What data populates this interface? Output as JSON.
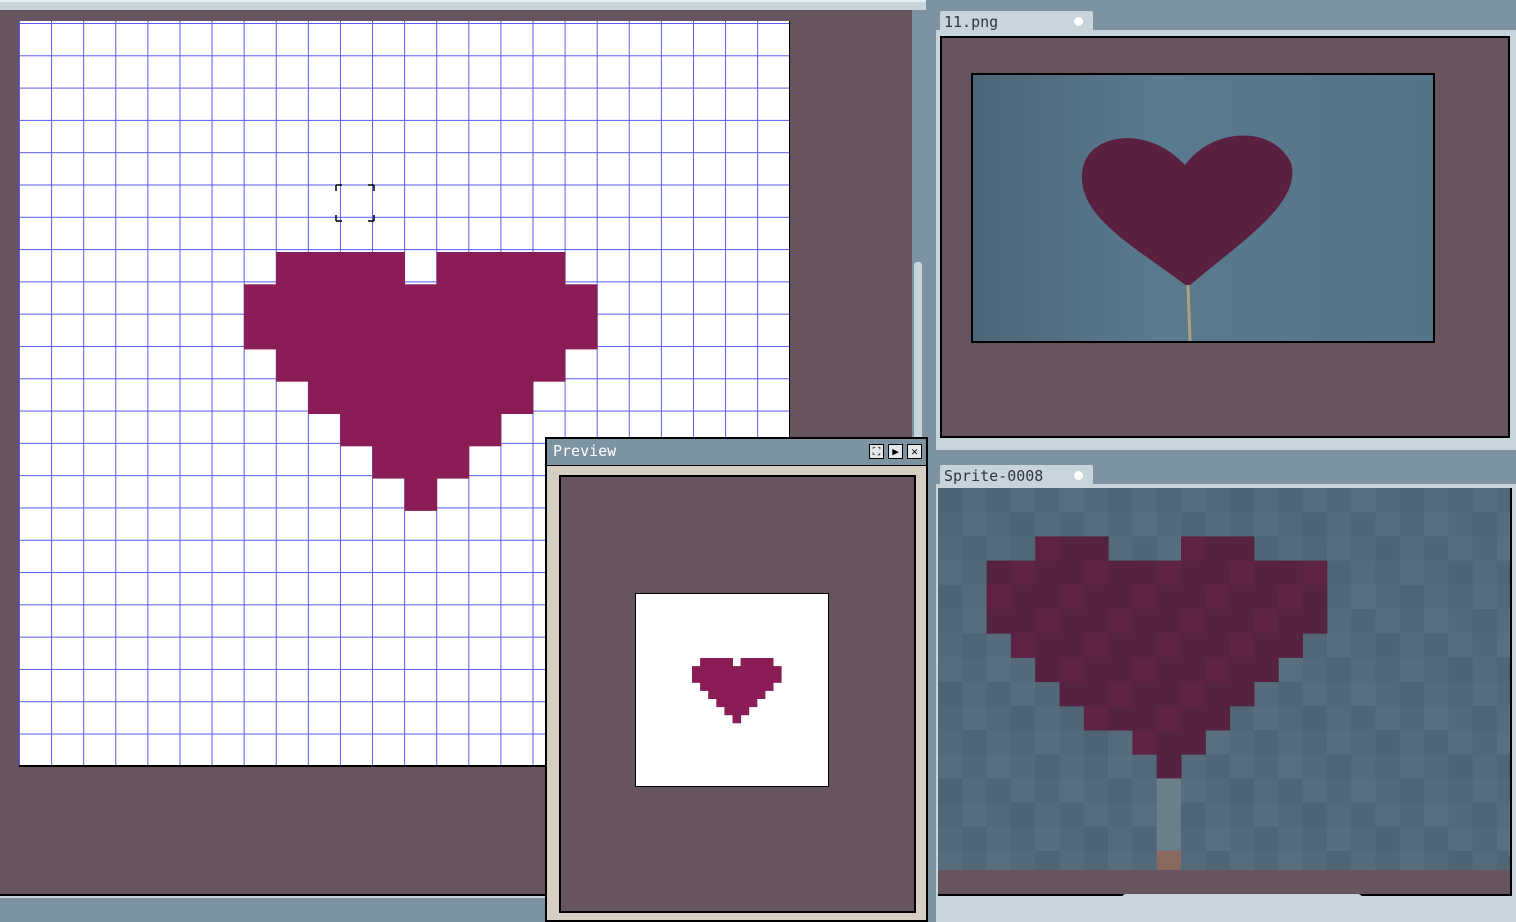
{
  "editor": {
    "grid_color": "#5a5af0",
    "pixel_color": "#8a1d55",
    "background_color": "#66555f"
  },
  "tabs": [
    {
      "label": "11.png"
    },
    {
      "label": "Sprite-0008"
    }
  ],
  "preview": {
    "title": "Preview",
    "buttons": [
      "center-icon",
      "play-icon",
      "close-icon"
    ]
  },
  "icons": {
    "cursor": "crosshair-icon"
  }
}
